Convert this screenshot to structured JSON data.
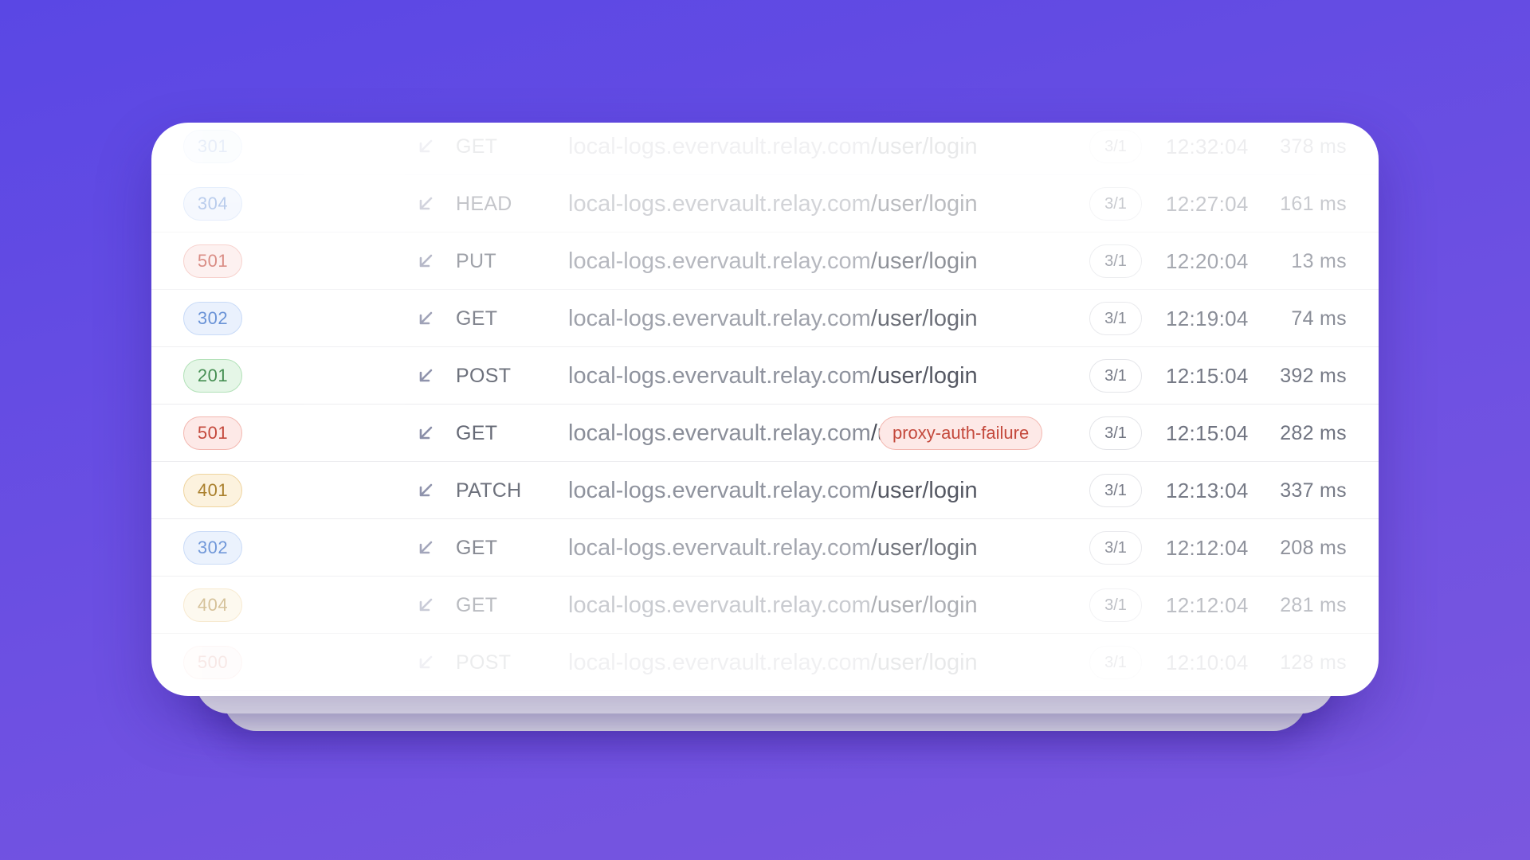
{
  "colors": {
    "background_start": "#5a47e4",
    "background_end": "#7a57df",
    "status_blue": "#4a7ccf",
    "status_red": "#c4493c",
    "status_green": "#3d8a4a",
    "status_yellow": "#a67a22"
  },
  "logs": [
    {
      "status": "301",
      "status_color": "blue",
      "method": "GET",
      "host": "local-logs.evervault.relay.com",
      "path": "/user/login",
      "tag": "",
      "ratio": "3/1",
      "time": "12:32:04",
      "duration": "378 ms",
      "direction_icon": "arrow-down-left-icon",
      "opacity": 0.12
    },
    {
      "status": "304",
      "status_color": "blue",
      "method": "HEAD",
      "host": "local-logs.evervault.relay.com",
      "path": "/user/login",
      "tag": "",
      "ratio": "3/1",
      "time": "12:27:04",
      "duration": "161 ms",
      "direction_icon": "arrow-down-left-icon",
      "opacity": 0.38
    },
    {
      "status": "501",
      "status_color": "red",
      "method": "PUT",
      "host": "local-logs.evervault.relay.com",
      "path": "/user/login",
      "tag": "",
      "ratio": "3/1",
      "time": "12:20:04",
      "duration": "13 ms",
      "direction_icon": "arrow-down-left-icon",
      "opacity": 0.62
    },
    {
      "status": "302",
      "status_color": "blue",
      "method": "GET",
      "host": "local-logs.evervault.relay.com",
      "path": "/user/login",
      "tag": "",
      "ratio": "3/1",
      "time": "12:19:04",
      "duration": "74 ms",
      "direction_icon": "arrow-down-left-icon",
      "opacity": 0.82
    },
    {
      "status": "201",
      "status_color": "green",
      "method": "POST",
      "host": "local-logs.evervault.relay.com",
      "path": "/user/login",
      "tag": "",
      "ratio": "3/1",
      "time": "12:15:04",
      "duration": "392 ms",
      "direction_icon": "arrow-down-left-icon",
      "opacity": 0.95
    },
    {
      "status": "501",
      "status_color": "red",
      "method": "GET",
      "host": "local-logs.evervault.relay.com",
      "path": "/user/login",
      "tag": "proxy-auth-failure",
      "ratio": "3/1",
      "time": "12:15:04",
      "duration": "282 ms",
      "direction_icon": "arrow-down-left-icon",
      "opacity": 1
    },
    {
      "status": "401",
      "status_color": "yellow",
      "method": "PATCH",
      "host": "local-logs.evervault.relay.com",
      "path": "/user/login",
      "tag": "",
      "ratio": "3/1",
      "time": "12:13:04",
      "duration": "337 ms",
      "direction_icon": "arrow-down-left-icon",
      "opacity": 0.95
    },
    {
      "status": "302",
      "status_color": "blue",
      "method": "GET",
      "host": "local-logs.evervault.relay.com",
      "path": "/user/login",
      "tag": "",
      "ratio": "3/1",
      "time": "12:12:04",
      "duration": "208 ms",
      "direction_icon": "arrow-down-left-icon",
      "opacity": 0.78
    },
    {
      "status": "404",
      "status_color": "yellow",
      "method": "GET",
      "host": "local-logs.evervault.relay.com",
      "path": "/user/login",
      "tag": "",
      "ratio": "3/1",
      "time": "12:12:04",
      "duration": "281 ms",
      "direction_icon": "arrow-down-left-icon",
      "opacity": 0.45
    },
    {
      "status": "500",
      "status_color": "red",
      "method": "POST",
      "host": "local-logs.evervault.relay.com",
      "path": "/user/login",
      "tag": "",
      "ratio": "3/1",
      "time": "12:10:04",
      "duration": "128 ms",
      "direction_icon": "arrow-down-left-icon",
      "opacity": 0.12
    }
  ]
}
